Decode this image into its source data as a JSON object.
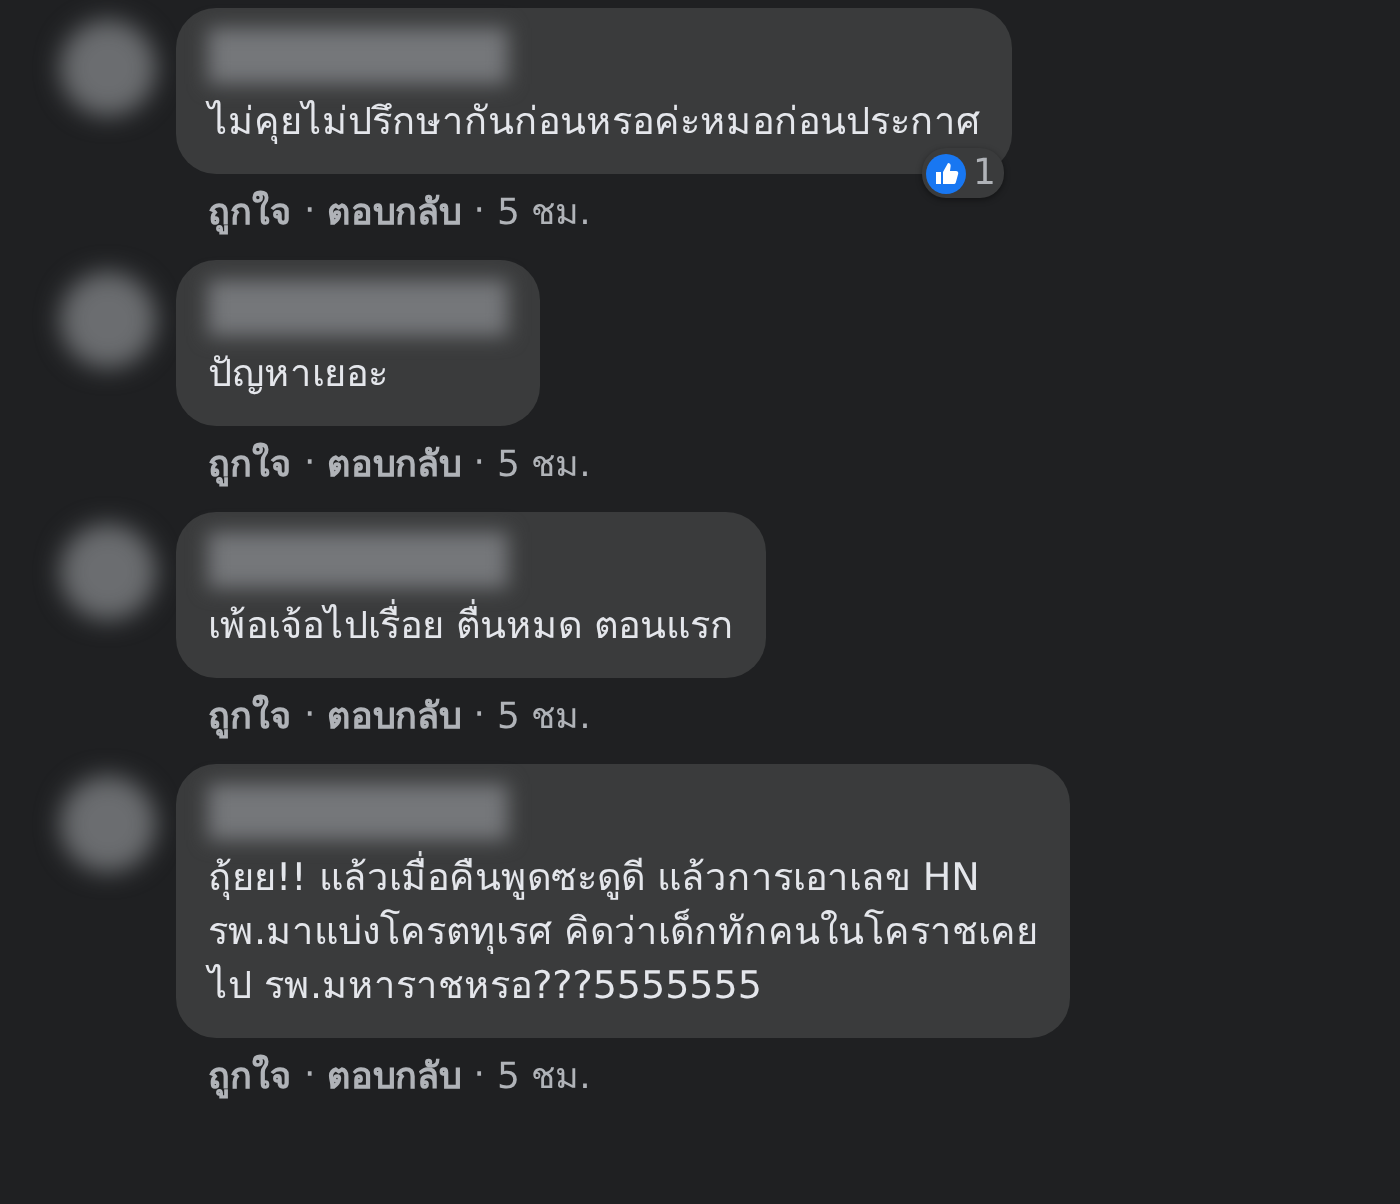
{
  "comments": [
    {
      "text": "ไม่คุยไม่ปรึกษากันก่อนหรอค่ะหมอก่อนประกาศ",
      "reaction": {
        "count": "1"
      },
      "actions": {
        "like": "ถูกใจ",
        "separator": "·",
        "reply": "ตอบกลับ",
        "time": "5 ชม."
      }
    },
    {
      "text": "ปัญหาเยอะ",
      "actions": {
        "like": "ถูกใจ",
        "separator": "·",
        "reply": "ตอบกลับ",
        "time": "5 ชม."
      }
    },
    {
      "text": "เพ้อเจ้อไปเรื่อย ตื่นหมด ตอนแรก",
      "actions": {
        "like": "ถูกใจ",
        "separator": "·",
        "reply": "ตอบกลับ",
        "time": "5 ชม."
      }
    },
    {
      "text": "ถุ้ยย!! แล้วเมื่อคืนพูดซะดูดี แล้วการเอาเลข HN\nรพ.มาแบ่งโครตทุเรศ คิดว่าเด็กทักคนในโคราชเคย\nไป รพ.มหาราชหรอ???5555555",
      "actions": {
        "like": "ถูกใจ",
        "separator": "·",
        "reply": "ตอบกลับ",
        "time": "5 ชม."
      }
    }
  ]
}
